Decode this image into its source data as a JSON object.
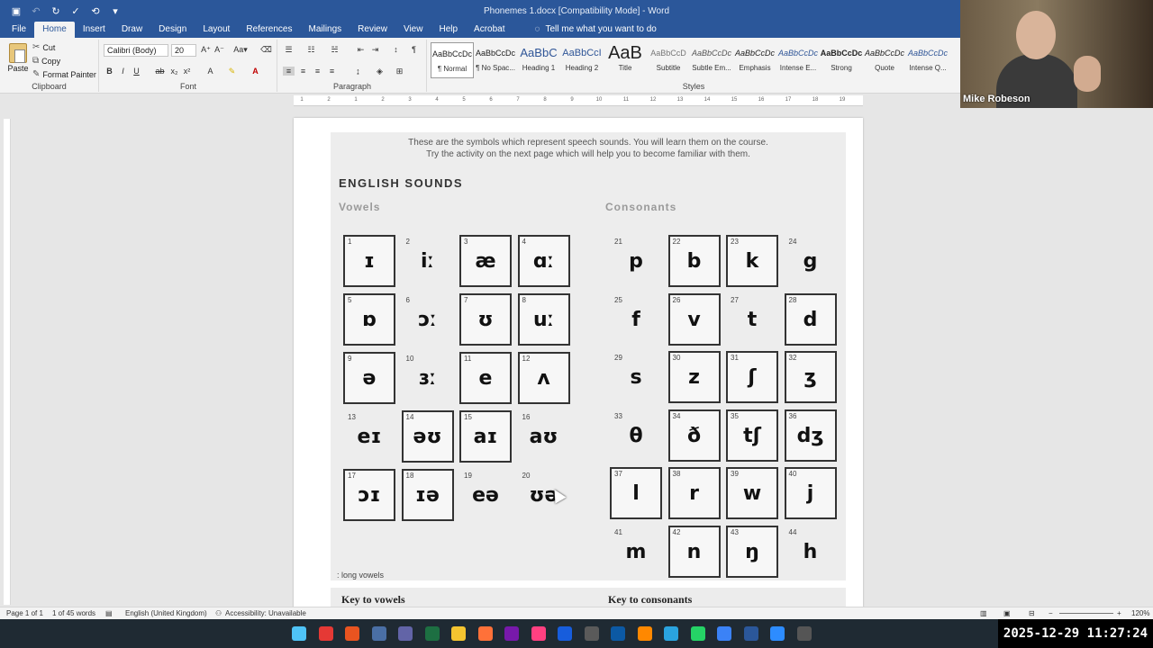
{
  "window": {
    "title": "Phonemes 1.docx [Compatibility Mode] - Word"
  },
  "tabs": [
    "File",
    "Home",
    "Insert",
    "Draw",
    "Design",
    "Layout",
    "References",
    "Mailings",
    "Review",
    "View",
    "Help",
    "Acrobat"
  ],
  "active_tab": "Home",
  "tell_me": "Tell me what you want to do",
  "clipboard": {
    "paste": "Paste",
    "cut": "Cut",
    "copy": "Copy",
    "format_painter": "Format Painter",
    "label": "Clipboard"
  },
  "font": {
    "name": "Calibri (Body)",
    "size": "20",
    "label": "Font"
  },
  "paragraph": {
    "label": "Paragraph"
  },
  "styles": {
    "label": "Styles",
    "items": [
      {
        "preview": "AaBbCcDc",
        "name": "¶ Normal"
      },
      {
        "preview": "AaBbCcDc",
        "name": "¶ No Spac..."
      },
      {
        "preview": "AaBbC",
        "name": "Heading 1"
      },
      {
        "preview": "AaBbCcI",
        "name": "Heading 2"
      },
      {
        "preview": "AaB",
        "name": "Title"
      },
      {
        "preview": "AaBbCcD",
        "name": "Subtitle"
      },
      {
        "preview": "AaBbCcDc",
        "name": "Subtle Em..."
      },
      {
        "preview": "AaBbCcDc",
        "name": "Emphasis"
      },
      {
        "preview": "AaBbCcDc",
        "name": "Intense E..."
      },
      {
        "preview": "AaBbCcDc",
        "name": "Strong"
      },
      {
        "preview": "AaBbCcDc",
        "name": "Quote"
      },
      {
        "preview": "AaBbCcDc",
        "name": "Intense Q..."
      }
    ]
  },
  "ruler": {
    "ticks": [
      "1",
      "2",
      "1",
      "2",
      "3",
      "4",
      "5",
      "6",
      "7",
      "8",
      "9",
      "10",
      "11",
      "12",
      "13",
      "14",
      "15",
      "16",
      "17",
      "18",
      "19"
    ]
  },
  "document": {
    "intro_line1": "These are the symbols which represent speech sounds. You will learn them on the course.",
    "intro_line2": "Try the activity on the next page which will help you to become familiar with them.",
    "heading": "ENGLISH SOUNDS",
    "vowels_title": "Vowels",
    "consonants_title": "Consonants",
    "long_vowels_note": ": long vowels",
    "vowels": [
      {
        "num": "1",
        "sym": "ɪ"
      },
      {
        "num": "2",
        "sym": "iː"
      },
      {
        "num": "3",
        "sym": "æ"
      },
      {
        "num": "4",
        "sym": "ɑː"
      },
      {
        "num": "5",
        "sym": "ɒ"
      },
      {
        "num": "6",
        "sym": "ɔː"
      },
      {
        "num": "7",
        "sym": "ʊ"
      },
      {
        "num": "8",
        "sym": "uː"
      },
      {
        "num": "9",
        "sym": "ə"
      },
      {
        "num": "10",
        "sym": "ɜː"
      },
      {
        "num": "11",
        "sym": "e"
      },
      {
        "num": "12",
        "sym": "ʌ"
      },
      {
        "num": "13",
        "sym": "eɪ"
      },
      {
        "num": "14",
        "sym": "əʊ"
      },
      {
        "num": "15",
        "sym": "aɪ"
      },
      {
        "num": "16",
        "sym": "aʊ"
      },
      {
        "num": "17",
        "sym": "ɔɪ"
      },
      {
        "num": "18",
        "sym": "ɪə"
      },
      {
        "num": "19",
        "sym": "eə"
      },
      {
        "num": "20",
        "sym": "ʊə"
      }
    ],
    "consonants": [
      {
        "num": "21",
        "sym": "p"
      },
      {
        "num": "22",
        "sym": "b"
      },
      {
        "num": "23",
        "sym": "k"
      },
      {
        "num": "24",
        "sym": "g"
      },
      {
        "num": "25",
        "sym": "f"
      },
      {
        "num": "26",
        "sym": "v"
      },
      {
        "num": "27",
        "sym": "t"
      },
      {
        "num": "28",
        "sym": "d"
      },
      {
        "num": "29",
        "sym": "s"
      },
      {
        "num": "30",
        "sym": "z"
      },
      {
        "num": "31",
        "sym": "ʃ"
      },
      {
        "num": "32",
        "sym": "ʒ"
      },
      {
        "num": "33",
        "sym": "θ"
      },
      {
        "num": "34",
        "sym": "ð"
      },
      {
        "num": "35",
        "sym": "tʃ"
      },
      {
        "num": "36",
        "sym": "dʒ"
      },
      {
        "num": "37",
        "sym": "l"
      },
      {
        "num": "38",
        "sym": "r"
      },
      {
        "num": "39",
        "sym": "w"
      },
      {
        "num": "40",
        "sym": "j"
      },
      {
        "num": "41",
        "sym": "m"
      },
      {
        "num": "42",
        "sym": "n"
      },
      {
        "num": "43",
        "sym": "ŋ"
      },
      {
        "num": "44",
        "sym": "h"
      }
    ],
    "key_vowels": "Key to vowels",
    "key_consonants": "Key to consonants"
  },
  "video": {
    "participant_name": "Mike Robeson"
  },
  "status": {
    "page": "Page 1 of 1",
    "words": "1 of 45 words",
    "language": "English (United Kingdom)",
    "accessibility": "Accessibility: Unavailable",
    "zoom": "120%"
  },
  "clock": "2025-12-29  11:27:24",
  "taskbar_icons": [
    "windows-start-icon",
    "acrobat-icon",
    "ubuntu-icon",
    "calculator-icon",
    "teams-icon",
    "excel-icon",
    "file-explorer-icon",
    "firefox-icon",
    "onenote-icon",
    "music-icon",
    "bitwarden-icon",
    "notepad-icon",
    "edge-icon",
    "vlc-icon",
    "telegram-icon",
    "whatsapp-icon",
    "chat-icon",
    "word-icon",
    "zoom-icon",
    "powertoys-icon"
  ]
}
